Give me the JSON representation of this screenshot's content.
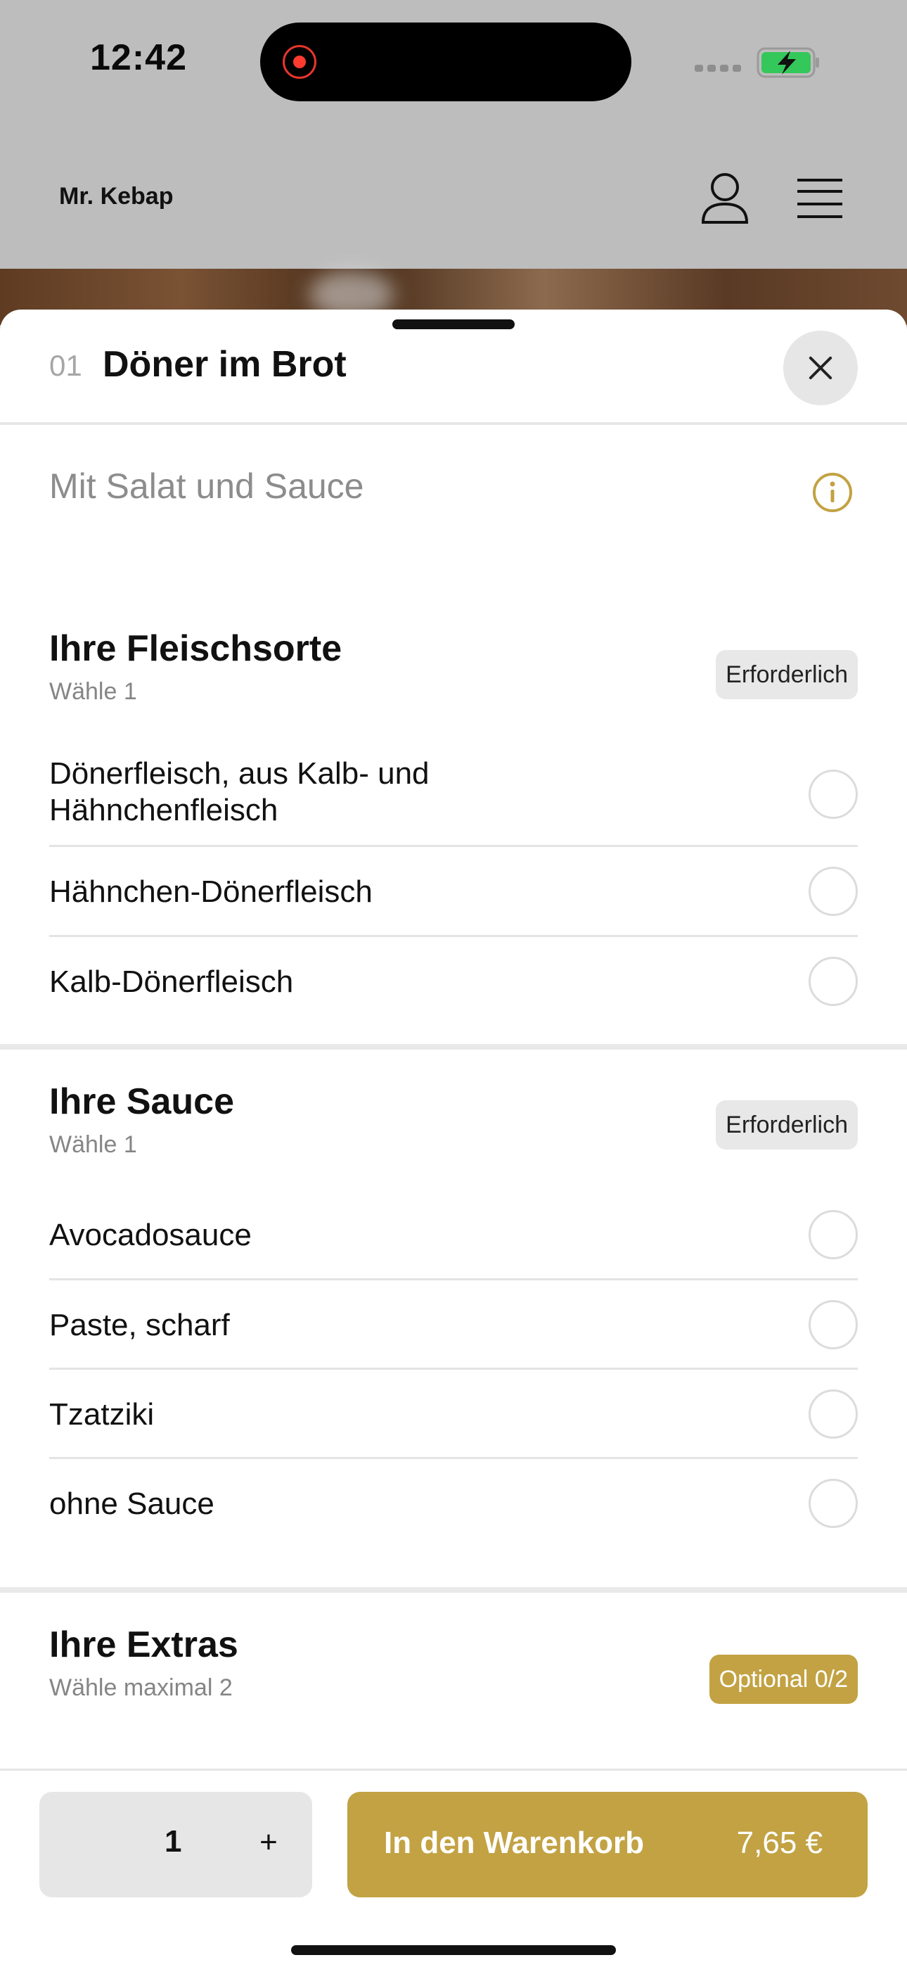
{
  "status_bar": {
    "time": "12:42"
  },
  "header": {
    "brand": "Mr. Kebap"
  },
  "sheet": {
    "item_number": "01",
    "title": "Döner im Brot",
    "description": "Mit Salat und Sauce"
  },
  "groups": [
    {
      "title": "Ihre Fleischsorte",
      "subtitle": "Wähle 1",
      "badge": "Erforderlich",
      "options": [
        {
          "label": "Dönerfleisch, aus Kalb- und Hähnchenfleisch"
        },
        {
          "label": "Hähnchen-Dönerfleisch"
        },
        {
          "label": "Kalb-Dönerfleisch"
        }
      ]
    },
    {
      "title": "Ihre Sauce",
      "subtitle": "Wähle 1",
      "badge": "Erforderlich",
      "options": [
        {
          "label": "Avocadosauce"
        },
        {
          "label": "Paste, scharf"
        },
        {
          "label": "Tzatziki"
        },
        {
          "label": "ohne Sauce"
        }
      ]
    },
    {
      "title": "Ihre Extras",
      "subtitle": "Wähle maximal 2",
      "badge": "Optional 0/2"
    }
  ],
  "footer": {
    "quantity": "1",
    "plus": "+",
    "add_to_cart": "In den Warenkorb",
    "price": "7,65 €"
  },
  "colors": {
    "accent": "#c2a243",
    "recording": "#ff3b30",
    "battery": "#34c759"
  },
  "icons": [
    "record-icon",
    "signal-icon",
    "battery-icon",
    "user-icon",
    "menu-icon",
    "close-icon",
    "info-icon"
  ]
}
